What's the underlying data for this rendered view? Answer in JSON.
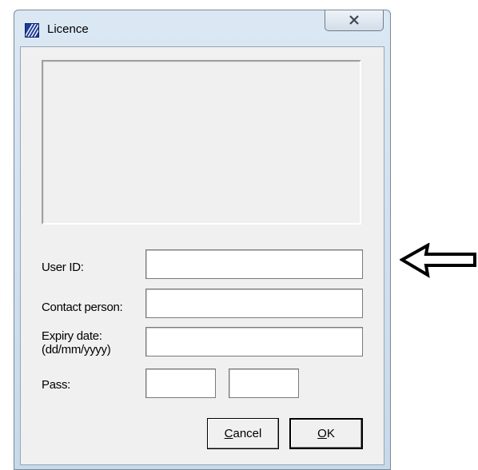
{
  "window": {
    "title": "Licence",
    "close_glyph": "✕",
    "app_icon": "licence-app-icon"
  },
  "form": {
    "user_id": {
      "label": "User ID:",
      "value": "",
      "placeholder": ""
    },
    "contact_person": {
      "label": "Contact person:",
      "value": "",
      "placeholder": ""
    },
    "expiry_date": {
      "label_line1": "Expiry date:",
      "label_line2": "(dd/mm/yyyy)",
      "value": "",
      "placeholder": ""
    },
    "pass": {
      "label": "Pass:",
      "value_1": "",
      "value_2": ""
    }
  },
  "buttons": {
    "cancel": {
      "accel": "C",
      "rest": "ancel"
    },
    "ok": {
      "accel": "O",
      "rest": "K"
    }
  },
  "annotation": {
    "icon": "left-arrow-icon",
    "color": "#000000"
  },
  "colors": {
    "client_bg": "#f0f0f0",
    "frame": "#c7d9ea",
    "accent": "#1f3d9c"
  }
}
